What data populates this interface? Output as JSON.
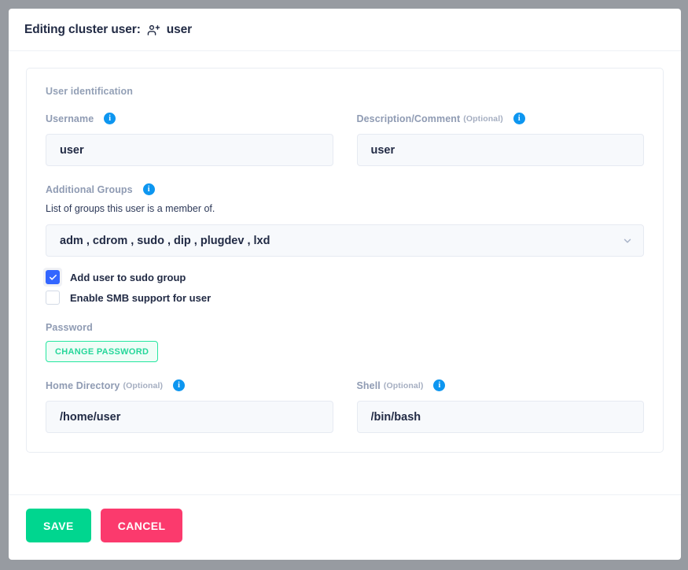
{
  "window": {
    "background_color": "#979ba1"
  },
  "header": {
    "title_prefix": "Editing cluster user:",
    "icon": "user-plus-icon",
    "username": "user"
  },
  "form": {
    "section_label": "User identification",
    "username": {
      "label": "Username",
      "info_icon": "info-icon",
      "value": "user",
      "placeholder": ""
    },
    "description": {
      "label": "Description/Comment",
      "optional": "(Optional)",
      "info_icon": "info-icon",
      "value": "user",
      "placeholder": ""
    },
    "groups": {
      "label": "Additional Groups",
      "info_icon": "info-icon",
      "helper": "List of groups this user is a member of.",
      "selected": "adm , cdrom , sudo , dip , plugdev , lxd",
      "chevron_icon": "chevron-down-icon"
    },
    "checkboxes": [
      {
        "label": "Add user to sudo group",
        "checked": true
      },
      {
        "label": "Enable SMB support for user",
        "checked": false
      }
    ],
    "password": {
      "label": "Password",
      "button_label": "CHANGE PASSWORD",
      "button_color": "#25d79a"
    },
    "home_directory": {
      "label": "Home Directory",
      "optional": "(Optional)",
      "info_icon": "info-icon",
      "value": "/home/user",
      "placeholder": ""
    },
    "shell": {
      "label": "Shell",
      "optional": "(Optional)",
      "info_icon": "info-icon",
      "value": "/bin/bash",
      "placeholder": ""
    }
  },
  "footer": {
    "save_label": "SAVE",
    "save_color": "#00d68f",
    "cancel_label": "CANCEL",
    "cancel_color": "#fb3a6d"
  }
}
